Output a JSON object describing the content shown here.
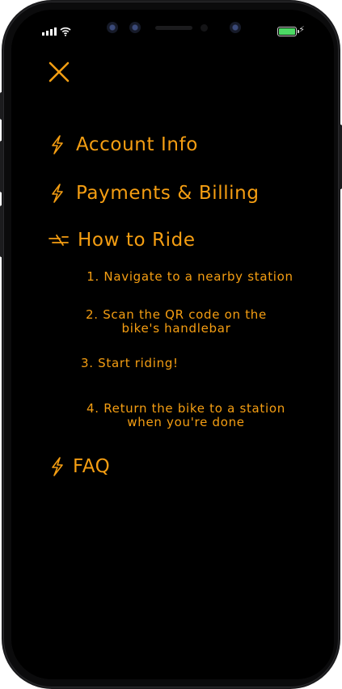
{
  "status_bar": {
    "signal_icon": "signal-bars-icon",
    "wifi_icon": "wifi-icon",
    "battery_icon": "battery-charging-icon",
    "battery_level": 1.0,
    "accent_battery": "#4cd964"
  },
  "nav": {
    "close_icon": "close-x-icon"
  },
  "colors": {
    "accent": "#f59e12",
    "background": "#000000"
  },
  "menu": {
    "account": {
      "label": "Account Info",
      "icon": "lightning-bolt-icon"
    },
    "payments": {
      "label": "Payments & Billing",
      "icon": "lightning-bolt-icon"
    },
    "how_to_ride": {
      "label": "How to Ride",
      "icon": "bike-icon",
      "steps": [
        {
          "line1": "1. Navigate to a nearby station",
          "line2": ""
        },
        {
          "line1": "2. Scan the QR code on the",
          "line2": "bike's handlebar"
        },
        {
          "line1": "3. Start riding!",
          "line2": ""
        },
        {
          "line1": "4. Return the bike to a station",
          "line2": "when you're done"
        }
      ]
    },
    "faq": {
      "label": "FAQ",
      "icon": "lightning-bolt-icon"
    }
  }
}
